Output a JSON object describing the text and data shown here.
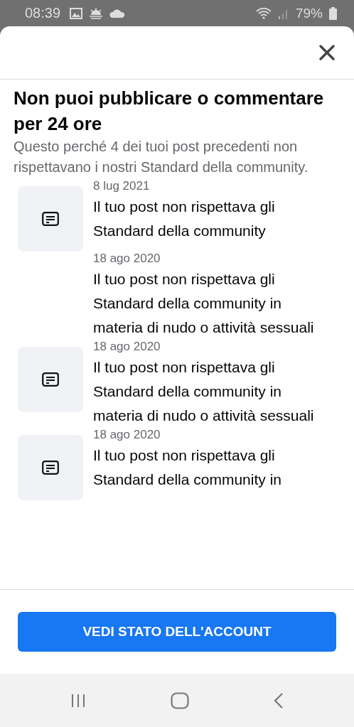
{
  "status_bar": {
    "time": "08:39",
    "battery": "79%"
  },
  "title": "Non puoi pubblicare o commentare per 24 ore",
  "subtitle": "Questo perché 4 dei tuoi post precedenti non rispettavano i nostri Standard della community.",
  "items": [
    {
      "kind": "with-icon",
      "date": "8 lug 2021",
      "text": "Il tuo post non rispettava gli Standard della community"
    },
    {
      "kind": "text-only",
      "date": "18 ago 2020",
      "text": "Il tuo post non rispettava gli Standard della community in materia di nudo o attività sessuali"
    },
    {
      "kind": "with-icon",
      "date": "18 ago 2020",
      "text": "Il tuo post non rispettava gli Standard della community in materia di nudo o attività sessuali"
    },
    {
      "kind": "with-icon",
      "date": "18 ago 2020",
      "text": "Il tuo post non rispettava gli Standard della community in"
    }
  ],
  "button": "VEDI STATO DELL'ACCOUNT"
}
